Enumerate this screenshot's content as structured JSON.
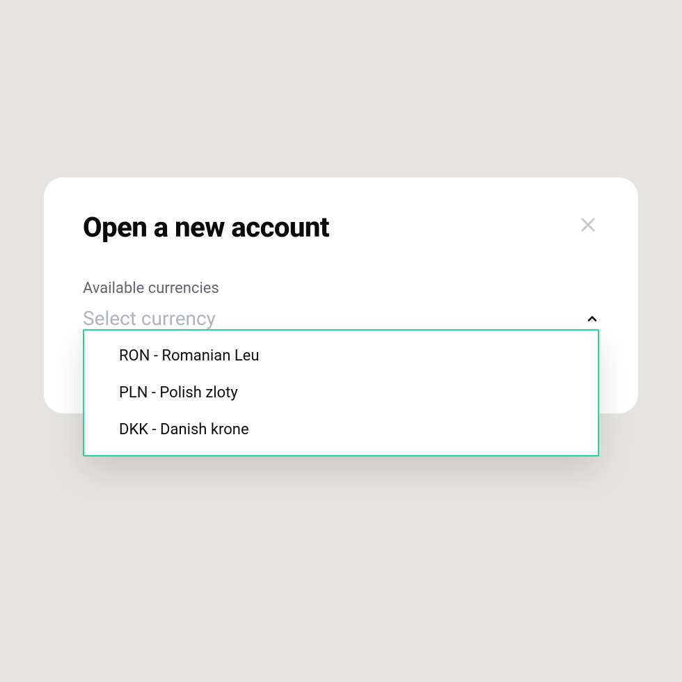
{
  "modal": {
    "title": "Open a new account",
    "close_icon": "close-icon"
  },
  "currency_field": {
    "label": "Available currencies",
    "placeholder": "Select currency",
    "options": [
      "RON - Romanian Leu",
      "PLN - Polish zloty",
      "DKK - Danish krone"
    ]
  },
  "colors": {
    "accent": "#2ad39a",
    "background": "#e6e4e0",
    "text_muted": "#5f6773",
    "placeholder": "#b0b6be"
  }
}
